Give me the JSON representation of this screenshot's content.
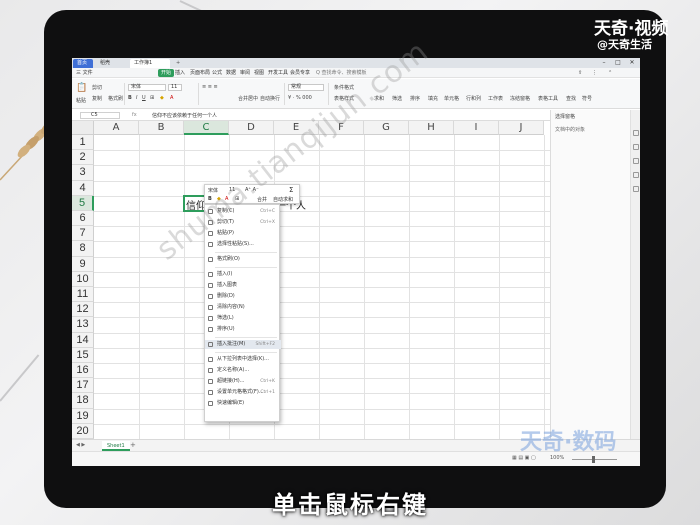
{
  "app": {
    "tabs": [
      "首页",
      "稻壳",
      "工作簿1"
    ],
    "active_tab": "工作簿1"
  },
  "menubar": {
    "file": "三 文件",
    "items": [
      "开始",
      "插入",
      "页面布局",
      "公式",
      "数据",
      "审阅",
      "视图",
      "开发工具",
      "会员专享"
    ],
    "active": "开始",
    "search_placeholder": "Q 查找命令、搜索模板"
  },
  "toolbar": {
    "paste": "粘贴",
    "cut": "剪切",
    "copy": "复制",
    "format_painter": "格式刷",
    "font_name": "宋体",
    "font_size": "11",
    "merge_center": "合并居中",
    "wrap_text": "自动换行",
    "number_format": "常规",
    "cond_format": "条件格式",
    "table_style": "表格样式",
    "sum": "求和",
    "filter": "筛选",
    "sort": "排序",
    "fill": "填充",
    "cell": "单元格",
    "row_col": "行和列",
    "worksheet": "工作表",
    "freeze": "冻结窗格",
    "table_tools": "表格工具",
    "find": "查找",
    "symbol": "符号"
  },
  "formula_bar": {
    "cell_ref": "C5",
    "fx": "fx",
    "content": "信仰不应该依赖于任何一个人"
  },
  "grid": {
    "columns": [
      "A",
      "B",
      "C",
      "D",
      "E",
      "F",
      "G",
      "H",
      "I",
      "J"
    ],
    "rows": [
      "1",
      "2",
      "3",
      "4",
      "5",
      "6",
      "7",
      "8",
      "9",
      "10",
      "11",
      "12",
      "13",
      "14",
      "15",
      "16",
      "17",
      "18",
      "19",
      "20"
    ],
    "selected_col": "C",
    "selected_row": "5",
    "cell_left_text": "信仰",
    "cell_right_text": "一个人"
  },
  "mini_toolbar": {
    "font": "宋体",
    "size": "11",
    "merge": "合并",
    "autosum": "自动求和"
  },
  "context_menu": {
    "items": [
      {
        "label": "复制(C)",
        "shortcut": "Ctrl+C"
      },
      {
        "label": "剪切(T)",
        "shortcut": "Ctrl+X"
      },
      {
        "label": "粘贴(P)",
        "shortcut": ""
      },
      {
        "label": "选择性粘贴(S)...",
        "shortcut": ""
      },
      {
        "label": "格式刷(O)",
        "shortcut": ""
      },
      {
        "label": "插入(I)",
        "shortcut": ""
      },
      {
        "label": "插入图表",
        "shortcut": ""
      },
      {
        "label": "删除(D)",
        "shortcut": ""
      },
      {
        "label": "清除内容(N)",
        "shortcut": ""
      },
      {
        "label": "筛选(L)",
        "shortcut": ""
      },
      {
        "label": "排序(U)",
        "shortcut": ""
      },
      {
        "label": "插入批注(M)",
        "shortcut": "Shift+F2"
      },
      {
        "label": "从下拉列表中选择(K)...",
        "shortcut": ""
      },
      {
        "label": "定义名称(A)...",
        "shortcut": ""
      },
      {
        "label": "超链接(H)...",
        "shortcut": "Ctrl+K"
      },
      {
        "label": "设置单元格格式(F)...",
        "shortcut": "Ctrl+1"
      },
      {
        "label": "快速编辑(E)",
        "shortcut": ""
      }
    ],
    "highlighted": "插入批注(M)"
  },
  "right_pane": {
    "title": "选择窗格",
    "subtitle": "文档中的对象"
  },
  "sheetbar": {
    "sheet": "Sheet1",
    "add": "+"
  },
  "status": {
    "zoom": "100%"
  },
  "watermark": {
    "url": "shuma.tianqijun.com",
    "brand_top": "天奇·视频",
    "brand_top2": "@天奇生活",
    "brand_bottom": "天奇·数码"
  },
  "caption": "单击鼠标右键",
  "colors": {
    "accent": "#2e9d5c",
    "tab_blue": "#3f6fd6",
    "bezel": "#0f0f10"
  }
}
